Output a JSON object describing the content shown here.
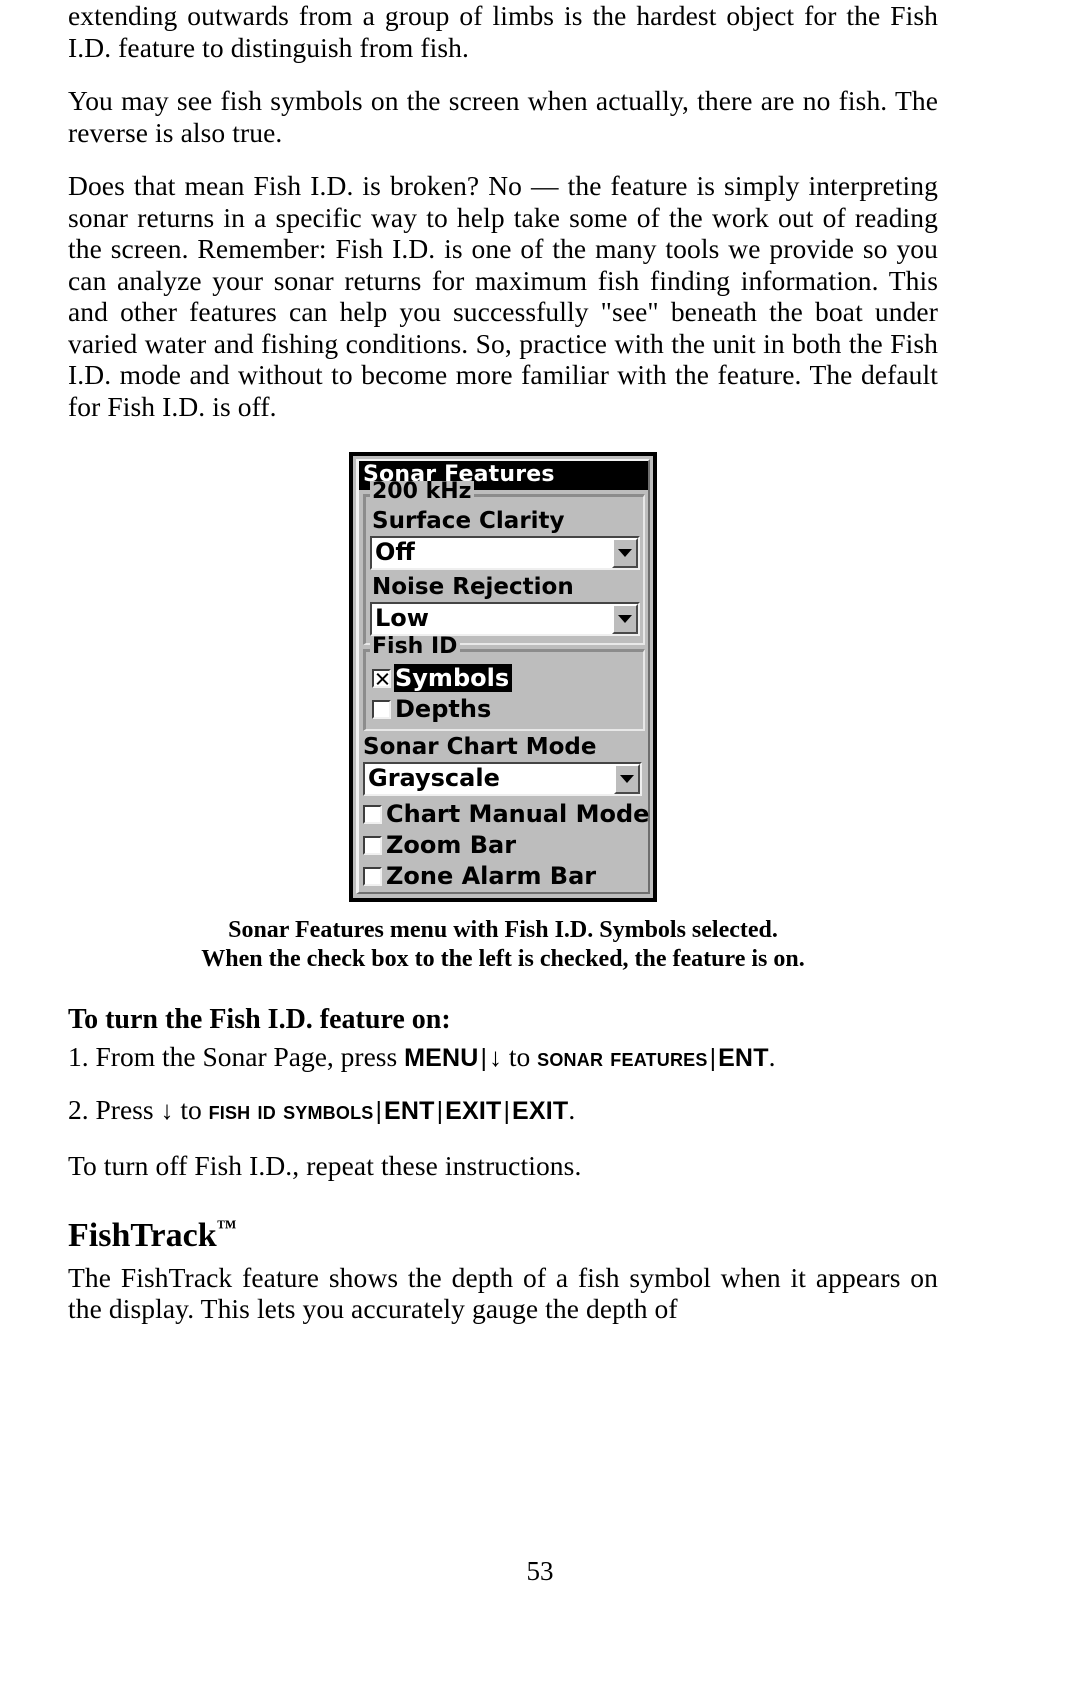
{
  "page": {
    "number": "53"
  },
  "paragraphs": {
    "p1": "extending outwards from a group of limbs is the hardest object for the Fish I.D. feature to distinguish from fish.",
    "p2": "You may see fish symbols on the screen when actually, there are no fish. The reverse is also true.",
    "p3": "Does that mean Fish I.D. is broken? No — the feature is simply interpreting sonar returns in a specific way to help take some of the work out of reading the screen. Remember: Fish I.D. is one of the many tools we provide so you can analyze your sonar returns for maximum fish finding information. This and other features can help you successfully \"see\" beneath the boat under varied water and fishing conditions. So, practice with the unit in both the Fish I.D. mode and without to become more familiar with the feature. The default for Fish I.D. is off.",
    "p_turnoff": "To turn off Fish I.D., repeat these instructions.",
    "p_fishtrack": "The FishTrack feature shows the depth of a fish symbol when it appears on the display. This lets you accurately gauge the depth of"
  },
  "device_dialog": {
    "title": "Sonar Features",
    "group_frequency": {
      "label": "200 kHz",
      "fields": [
        {
          "label": "Surface Clarity",
          "value": "Off",
          "icon": "chevron-down-icon"
        },
        {
          "label": "Noise Rejection",
          "value": "Low",
          "icon": "chevron-down-icon"
        }
      ]
    },
    "group_fish_id": {
      "label": "Fish ID",
      "checkboxes": [
        {
          "label": "Symbols",
          "checked": true,
          "selected": true
        },
        {
          "label": "Depths",
          "checked": false,
          "selected": false
        }
      ]
    },
    "chart_mode": {
      "label": "Sonar Chart Mode",
      "value": "Grayscale",
      "icon": "chevron-down-icon"
    },
    "bottom_checkboxes": [
      {
        "label": "Chart Manual Mode",
        "checked": false
      },
      {
        "label": "Zoom Bar",
        "checked": false
      },
      {
        "label": "Zone Alarm Bar",
        "checked": false
      }
    ],
    "colors": {
      "face": "#bdbdbd",
      "title_bg": "#000000",
      "title_fg": "#ffffff",
      "field_bg": "#ffffff"
    }
  },
  "caption": {
    "line1": "Sonar Features menu with Fish I.D. Symbols selected.",
    "line2": "When the check box to the left is checked, the feature is on."
  },
  "instructions": {
    "heading": "To turn the Fish I.D. feature on:",
    "step1": {
      "lead": "1. From the Sonar Page, press ",
      "key1": "MENU",
      "sep1": "|",
      "arrow": "↓",
      "mid": " to ",
      "target": "Sonar Features",
      "sep2": "|",
      "key2": "ENT",
      "end": "."
    },
    "step2": {
      "lead": "2. Press ",
      "arrow": "↓",
      "mid": " to ",
      "target": "Fish ID Symbols",
      "sep1": "|",
      "key1": "ENT",
      "sep2": "|",
      "key2": "EXIT",
      "sep3": "|",
      "key3": "EXIT",
      "end": "."
    }
  },
  "section": {
    "title": "FishTrack",
    "tm": "™"
  }
}
